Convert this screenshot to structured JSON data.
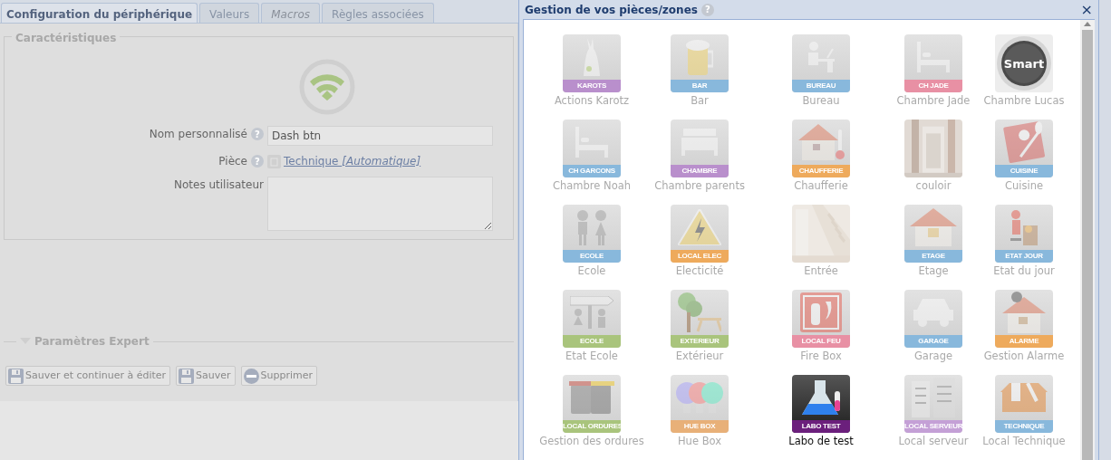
{
  "tabs": [
    {
      "label": "Configuration du périphérique",
      "selected": true,
      "disabled": false
    },
    {
      "label": "Valeurs",
      "selected": false,
      "disabled": false
    },
    {
      "label": "Macros",
      "selected": false,
      "disabled": true
    },
    {
      "label": "Règles associées",
      "selected": false,
      "disabled": false
    }
  ],
  "characteristics": {
    "legend": "Caractéristiques",
    "fields": [
      {
        "kind": "text",
        "label": "Nom personnalisé",
        "help": "?",
        "value": "Dash btn"
      },
      {
        "kind": "link",
        "label": "Pièce",
        "help": "?",
        "value": "Technique",
        "note": "[Automatique]"
      },
      {
        "kind": "textarea",
        "label": "Notes utilisateur"
      }
    ]
  },
  "expert": {
    "legend": "Paramètres Expert"
  },
  "buttons": [
    {
      "kind": "save",
      "label": "Sauver et continuer à éditer"
    },
    {
      "kind": "save",
      "label": "Sauver"
    },
    {
      "kind": "delete",
      "label": "Supprimer"
    }
  ],
  "dialog": {
    "title": "Gestion de vos pièces/zones",
    "help": "?",
    "close": "×",
    "rooms": [
      {
        "name": "Actions Karotz",
        "badge": "KAROTS",
        "color": "#b98fcc",
        "selected": false
      },
      {
        "name": "Bar",
        "badge": "BAR",
        "color": "#88b8dc",
        "selected": false
      },
      {
        "name": "Bureau",
        "badge": "BUREAU",
        "color": "#88b8dc",
        "selected": false
      },
      {
        "name": "Chambre Jade",
        "badge": "CH JADE",
        "color": "#e890a4",
        "selected": false
      },
      {
        "name": "Chambre Lucas",
        "logo_text": "Smart",
        "selected": false
      },
      {
        "name": "Chambre Noah",
        "badge": "CH GARCONS",
        "color": "#88b8dc",
        "selected": false
      },
      {
        "name": "Chambre parents",
        "badge": "CHAMBRE",
        "color": "#b98fcc",
        "selected": false
      },
      {
        "name": "Chaufferie",
        "badge": "CHAUFFERIE",
        "color": "#eeaa5c",
        "selected": false
      },
      {
        "name": "couloir",
        "kind": "picture",
        "selected": false
      },
      {
        "name": "Cuisine",
        "badge": "CUISINE",
        "color": "#88b8dc",
        "selected": false
      },
      {
        "name": "Ecole",
        "badge": "ECOLE",
        "color": "#88b8dc",
        "selected": false
      },
      {
        "name": "Electicité",
        "badge": "LOCAL ELEC",
        "color": "#eeaa5c",
        "selected": false
      },
      {
        "name": "Entrée",
        "kind": "picture",
        "selected": false
      },
      {
        "name": "Etage",
        "badge": "ETAGE",
        "color": "#88b8dc",
        "selected": false
      },
      {
        "name": "Etat du jour",
        "badge": "ETAT JOUR",
        "color": "#88b8dc",
        "selected": false
      },
      {
        "name": "Etat Ecole",
        "badge": "ECOLE",
        "color": "#a9c47c",
        "selected": false
      },
      {
        "name": "Extérieur",
        "badge": "EXTERIEUR",
        "color": "#a9c47c",
        "selected": false
      },
      {
        "name": "Fire Box",
        "badge": "LOCAL FEU",
        "color": "#e890a4",
        "selected": false
      },
      {
        "name": "Garage",
        "badge": "GARAGE",
        "color": "#88b8dc",
        "selected": false
      },
      {
        "name": "Gestion Alarme",
        "badge": "ALARME",
        "color": "#eeaa5c",
        "selected": false
      },
      {
        "name": "Gestion des ordures",
        "badge": "LOCAL ORDURES",
        "color": "#a9c47c",
        "selected": false
      },
      {
        "name": "Hue Box",
        "badge": "HUE BOX",
        "color": "#e8b078",
        "selected": false
      },
      {
        "name": "Labo de test",
        "badge": "LABO TEST",
        "color": "#6b1f7c",
        "selected": true
      },
      {
        "name": "Local serveur",
        "badge": "LOCAL SERVEUR",
        "color": "#c4a0d6",
        "selected": false
      },
      {
        "name": "Local Technique",
        "badge": "TECHNIQUE",
        "color": "#88b8dc",
        "selected": false
      }
    ]
  }
}
